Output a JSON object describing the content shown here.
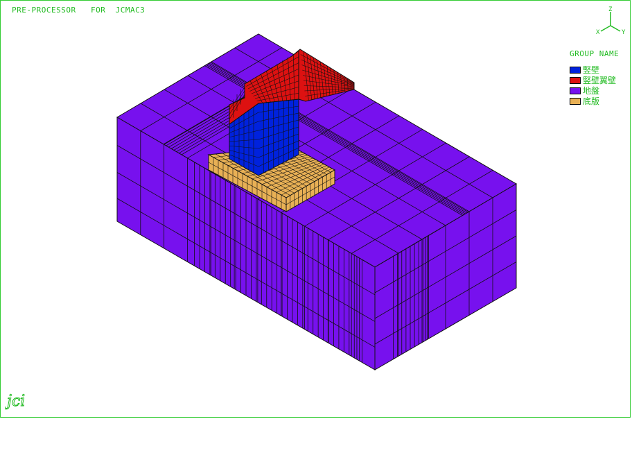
{
  "window": {
    "title": "PRE-PROCESSOR   FOR  JCMAC3"
  },
  "legend": {
    "title": "GROUP NAME",
    "items": [
      {
        "label": "竪壁",
        "color": "#0022dd"
      },
      {
        "label": "竪壁翼壁",
        "color": "#dd1111"
      },
      {
        "label": "地盤",
        "color": "#7711ee"
      },
      {
        "label": "底版",
        "color": "#e8b055"
      }
    ]
  },
  "axes": {
    "x_label": "X",
    "y_label": "Y",
    "z_label": "Z"
  },
  "logo": {
    "text": "jci"
  },
  "colors": {
    "frame": "#33cc33",
    "text": "#22bb22",
    "mesh_line": "#111111",
    "ground_top": "#7711ee",
    "ground_side": "#7711ee"
  }
}
